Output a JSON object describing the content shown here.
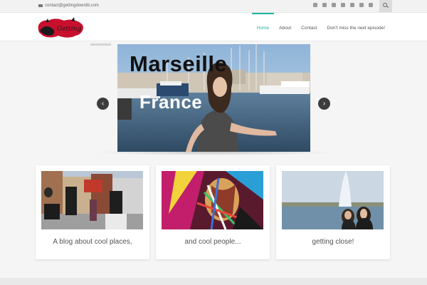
{
  "topbar": {
    "contact_email": "contact@gettingdowntb.com",
    "social_icons": [
      "instagram-icon",
      "youtube-icon",
      "google-plus-icon",
      "linkedin-icon",
      "pinterest-icon",
      "facebook-icon",
      "twitter-icon"
    ]
  },
  "nav": {
    "items": [
      {
        "label": "Home",
        "active": true
      },
      {
        "label": "About",
        "active": false
      },
      {
        "label": "Contact",
        "active": false
      },
      {
        "label": "Don't miss the next episode!",
        "active": false
      }
    ],
    "accent": "#1eb4a5"
  },
  "slider": {
    "line1": "Marseille",
    "line2": "France",
    "prev_icon": "chevron-left-icon",
    "next_icon": "chevron-right-icon"
  },
  "cards": [
    {
      "caption": "A blog about cool places,"
    },
    {
      "caption": "and cool people..."
    },
    {
      "caption": "getting close!"
    }
  ]
}
